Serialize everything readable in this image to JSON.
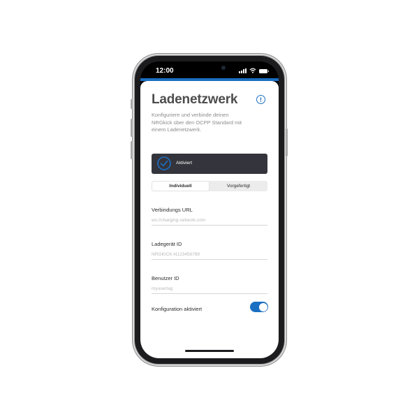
{
  "statusbar": {
    "time": "12:00",
    "icons": [
      "signal-icon",
      "wifi-icon",
      "battery-icon"
    ]
  },
  "colors": {
    "accent": "#1b6fc2",
    "card_background": "#34343c",
    "title": "#4d4d4d"
  },
  "header": {
    "title": "Ladenetzwerk",
    "info_icon": "info-icon",
    "info_glyph": "!",
    "subtitle": "Konfiguriere und verbinde deinen NRGkick über den OCPP Standard mit einem Ladenetzwerk."
  },
  "status_card": {
    "icon": "check-circle-icon",
    "label": "Aktiviert"
  },
  "segmented": {
    "options": [
      "Individuell",
      "Vorgefertigt"
    ],
    "selected": "Individuell"
  },
  "fields": {
    "connection_url": {
      "label": "Verbindungs URL",
      "value": "",
      "placeholder": "ws://charging-network.com"
    },
    "charger_id": {
      "label": "Ladegerät ID",
      "value": "",
      "placeholder": "NRGKICK-N123456789"
    },
    "user_id": {
      "label": "Benutzer ID",
      "value": "",
      "placeholder": "myusertag"
    }
  },
  "config_toggle": {
    "label": "Konfiguration aktiviert",
    "enabled": true
  }
}
